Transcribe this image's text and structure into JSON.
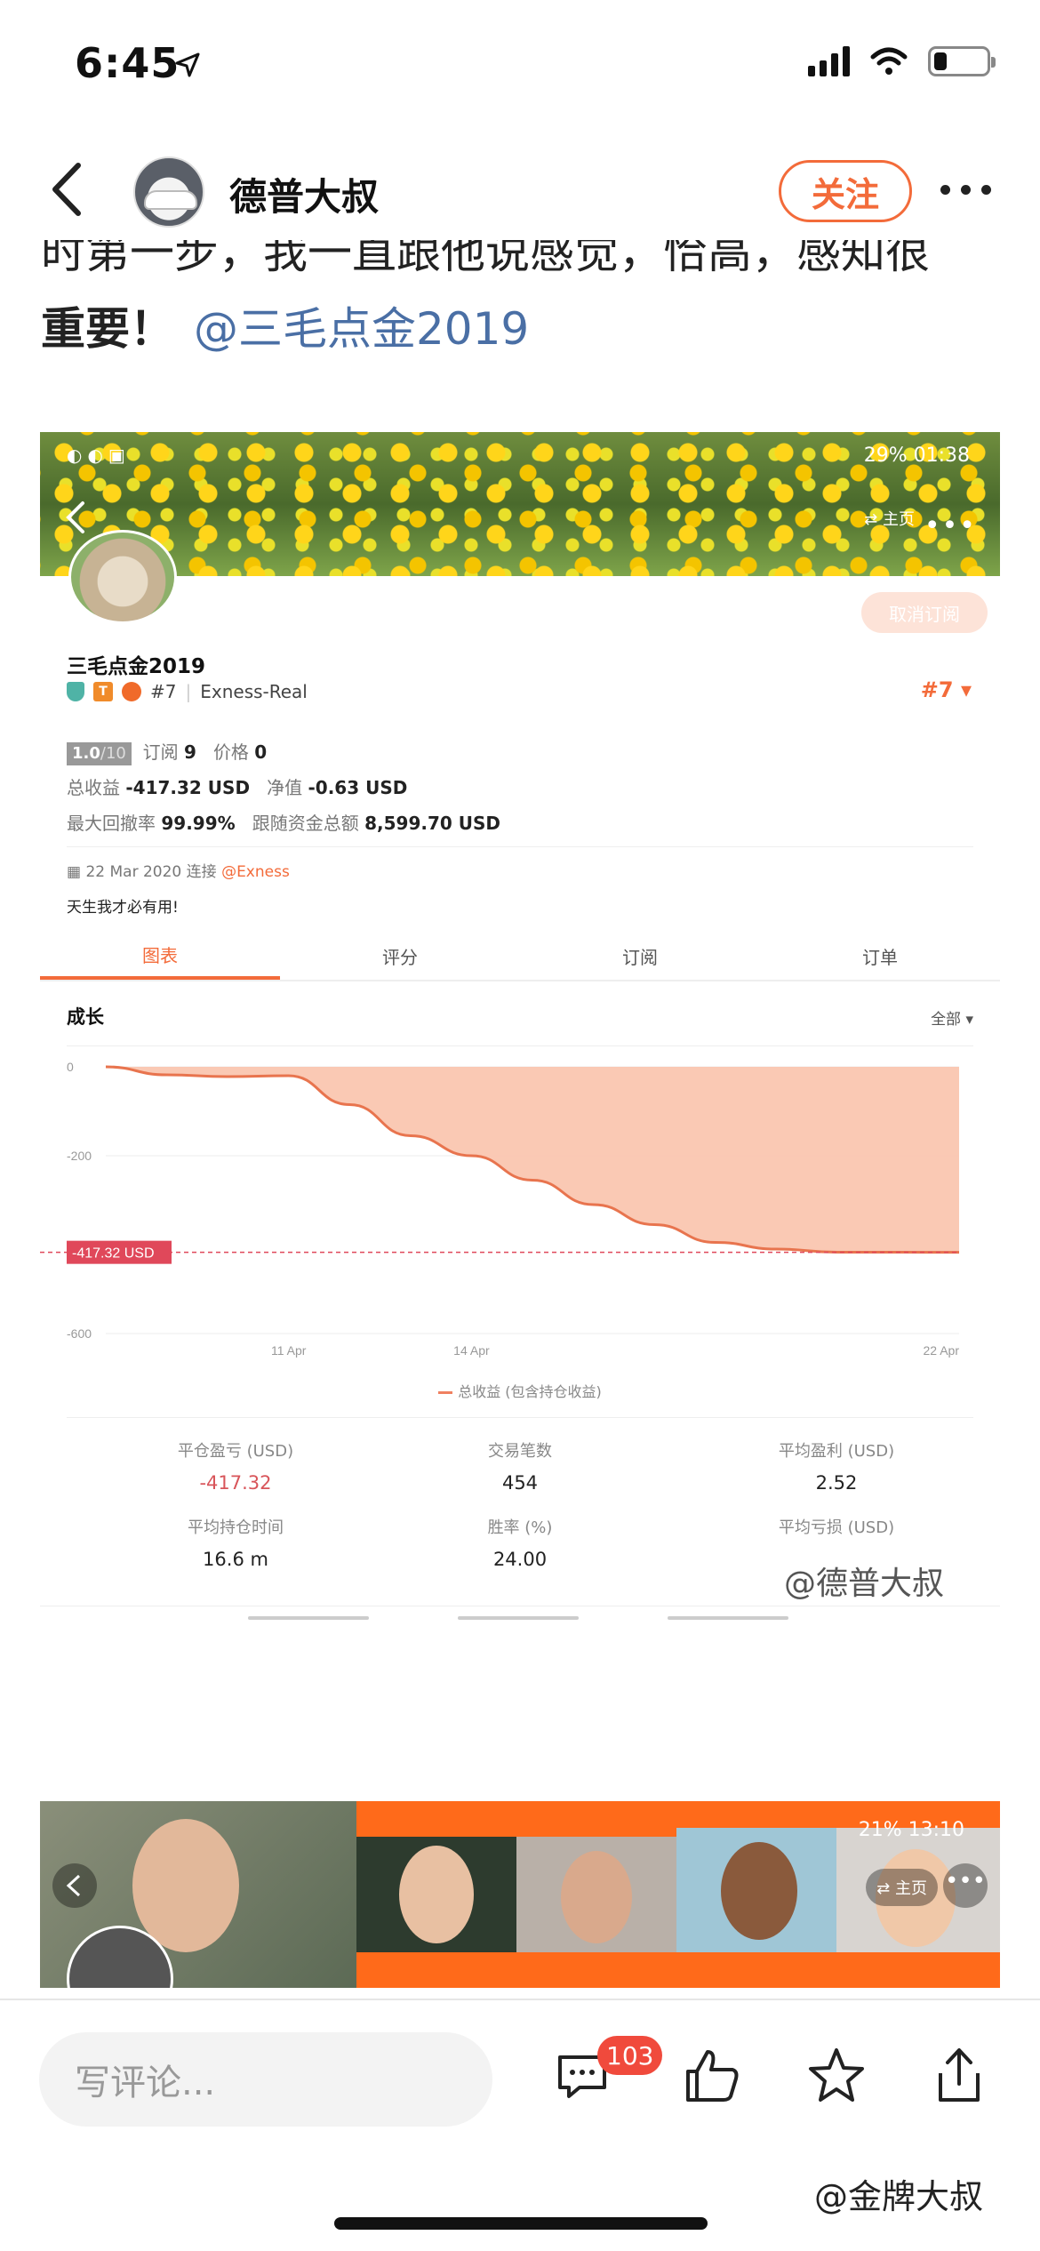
{
  "status_bar": {
    "time": "6:45"
  },
  "header": {
    "title": "德普大叔",
    "follow_label": "关注"
  },
  "post": {
    "clipped_line": "时第一步，我一直跟他说感觉，恰高，感知很",
    "text": "重要！",
    "mention": "@三毛点金2019"
  },
  "embedded": {
    "banner_status": "29% 01:38",
    "home_label": "⇄ 主页",
    "unsubscribe_label": "取消订阅",
    "profile_name": "三毛点金2019",
    "rank": "#7",
    "broker": "Exness-Real",
    "rank_right": "#7 ▾",
    "score": "1.0",
    "score_max": "/10",
    "subs_label": "订阅",
    "subs_value": "9",
    "price_label": "价格",
    "price_value": "0",
    "total_profit_label": "总收益",
    "total_profit_value": "-417.32 USD",
    "equity_label": "净值",
    "equity_value": "-0.63 USD",
    "max_dd_label": "最大回撤率",
    "max_dd_value": "99.99%",
    "follow_funds_label": "跟随资金总额",
    "follow_funds_value": "8,599.70 USD",
    "connected_date": "22 Mar 2020 连接",
    "connected_broker": "@Exness",
    "bio": "天生我才必有用!",
    "tabs": [
      "图表",
      "评分",
      "订阅",
      "订单"
    ],
    "growth_title": "成长",
    "growth_filter": "全部 ▾",
    "legend": "总收益 (包含持仓收益)",
    "metrics": [
      {
        "label": "平仓盈亏 (USD)",
        "value": "-417.32",
        "negative": true
      },
      {
        "label": "交易笔数",
        "value": "454"
      },
      {
        "label": "平均盈利 (USD)",
        "value": "2.52"
      },
      {
        "label": "平均持仓时间",
        "value": "16.6 m"
      },
      {
        "label": "胜率 (%)",
        "value": "24.00"
      },
      {
        "label": "平均亏损 (USD)",
        "value": ""
      }
    ],
    "watermark": "@德普大叔"
  },
  "chart_data": {
    "type": "area",
    "title": "",
    "xlabel": "",
    "ylabel": "",
    "x_ticks": [
      "11 Apr",
      "14 Apr",
      "22 Apr"
    ],
    "y_ticks": [
      0,
      -200,
      -600
    ],
    "ylim": [
      -600,
      0
    ],
    "series": [
      {
        "name": "总收益 (包含持仓收益)",
        "x": [
          "Apr 8",
          "Apr 9",
          "Apr 10",
          "Apr 11",
          "Apr 12",
          "Apr 13",
          "Apr 14",
          "Apr 15",
          "Apr 16",
          "Apr 17",
          "Apr 18",
          "Apr 19",
          "Apr 20",
          "Apr 21",
          "Apr 22"
        ],
        "values": [
          0,
          -18,
          -22,
          -20,
          -85,
          -155,
          -200,
          -255,
          -310,
          -355,
          -395,
          -410,
          -417,
          -417,
          -417.32
        ]
      }
    ],
    "current_value_label": "-417.32 USD",
    "colors": {
      "line": "#e8744e",
      "fill": "#f9c3ac",
      "marker_bg": "#e0485a"
    },
    "grid": true
  },
  "embedded2": {
    "status": "21% 13:10",
    "home_label": "⇄ 主页"
  },
  "bottom_bar": {
    "comment_placeholder": "写评论...",
    "comment_count": "103",
    "watermark": "@金牌大叔"
  }
}
